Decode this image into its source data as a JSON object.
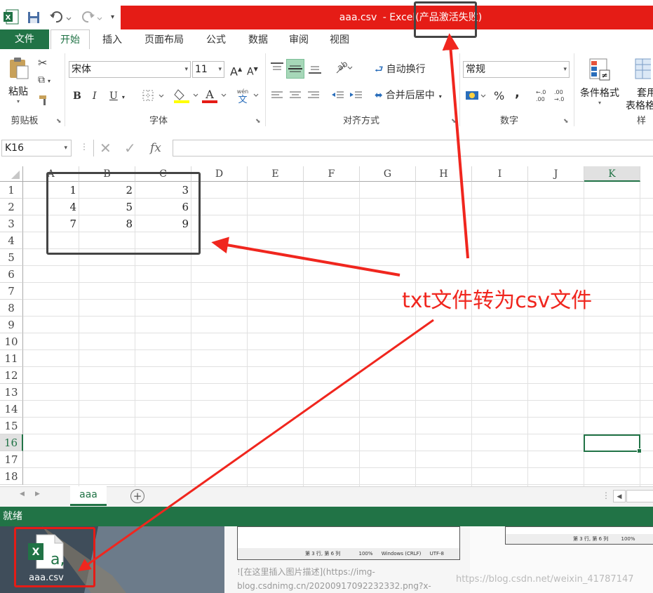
{
  "titlebar": {
    "file_title": "aaa.csv",
    "title_suffix": " - Excel(产品激活失败)",
    "app_icon": "excel-icon"
  },
  "tabs": [
    "文件",
    "开始",
    "插入",
    "页面布局",
    "公式",
    "数据",
    "审阅",
    "视图"
  ],
  "ribbon": {
    "paste_label": "粘贴",
    "clipboard_group": "剪贴板",
    "font_name": "宋体",
    "font_size": "11",
    "font_group": "字体",
    "bold": "B",
    "italic": "I",
    "underline": "U",
    "grow_font": "A",
    "shrink_font": "A",
    "wrap_text": "自动换行",
    "merge_center": "合并后居中",
    "align_group": "对齐方式",
    "number_format": "常规",
    "percent": "%",
    "comma": ",",
    "number_group": "数字",
    "conditional_format": "条件格式",
    "table_format_1": "套用",
    "table_format_2": "表格格",
    "styles_group": "样"
  },
  "formula_bar": {
    "name_box": "K16",
    "fx": "fx",
    "formula_value": ""
  },
  "columns": [
    "A",
    "B",
    "C",
    "D",
    "E",
    "F",
    "G",
    "H",
    "I",
    "J",
    "K"
  ],
  "rows": [
    "1",
    "2",
    "3",
    "4",
    "5",
    "6",
    "7",
    "8",
    "9",
    "10",
    "11",
    "12",
    "13",
    "14",
    "15",
    "16",
    "17",
    "18"
  ],
  "cells": [
    [
      "1",
      "2",
      "3"
    ],
    [
      "4",
      "5",
      "6"
    ],
    [
      "7",
      "8",
      "9"
    ]
  ],
  "active_cell": "K16",
  "sheet_tab": "aaa",
  "status": "就绪",
  "desktop": {
    "file_icon_label": "aaa.csv",
    "preview_status_1": "第 3 行, 第 6 列",
    "preview_zoom": "100%",
    "preview_eol": "Windows (CRLF)",
    "preview_encoding": "UTF-8",
    "markdown_line_1": "![在这里插入图片描述](https://img-",
    "markdown_line_2": "blog.csdnimg.cn/20200917092232332.png?x-",
    "watermark": "https://blog.csdn.net/weixin_41787147"
  },
  "annotation": {
    "text": "txt文件转为csv文件",
    "color": "#f0261e"
  },
  "colors": {
    "excel_green": "#217346",
    "title_red": "#e51c16",
    "annotation_red": "#f0261e"
  }
}
